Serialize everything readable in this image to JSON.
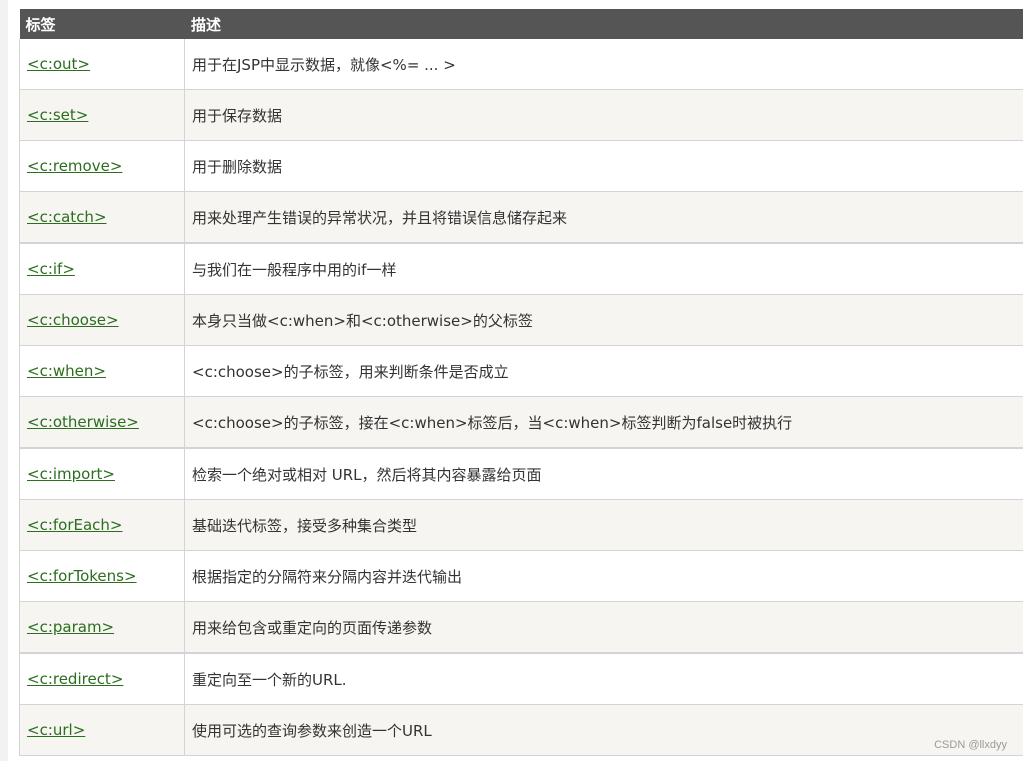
{
  "table": {
    "headers": [
      "标签",
      "描述"
    ],
    "rows": [
      {
        "tag": "<c:out>",
        "desc": "用于在JSP中显示数据，就像<%= ... >"
      },
      {
        "tag": "<c:set>",
        "desc": "用于保存数据"
      },
      {
        "tag": "<c:remove>",
        "desc": "用于删除数据"
      },
      {
        "tag": "<c:catch>",
        "desc": "用来处理产生错误的异常状况，并且将错误信息储存起来"
      },
      {
        "tag": "<c:if>",
        "desc": "与我们在一般程序中用的if一样"
      },
      {
        "tag": "<c:choose>",
        "desc": "本身只当做<c:when>和<c:otherwise>的父标签"
      },
      {
        "tag": "<c:when>",
        "desc": "<c:choose>的子标签，用来判断条件是否成立"
      },
      {
        "tag": "<c:otherwise>",
        "desc": "<c:choose>的子标签，接在<c:when>标签后，当<c:when>标签判断为false时被执行"
      },
      {
        "tag": "<c:import>",
        "desc": "检索一个绝对或相对 URL，然后将其内容暴露给页面"
      },
      {
        "tag": "<c:forEach>",
        "desc": "基础迭代标签，接受多种集合类型"
      },
      {
        "tag": "<c:forTokens>",
        "desc": "根据指定的分隔符来分隔内容并迭代输出"
      },
      {
        "tag": "<c:param>",
        "desc": "用来给包含或重定向的页面传递参数"
      },
      {
        "tag": "<c:redirect>",
        "desc": "重定向至一个新的URL."
      },
      {
        "tag": "<c:url>",
        "desc": "使用可选的查询参数来创造一个URL"
      }
    ]
  },
  "watermark": "CSDN @llxdyy",
  "colors": {
    "header_bg": "#555555",
    "link": "#2a6e1e",
    "alt_row": "#f6f5f1"
  }
}
